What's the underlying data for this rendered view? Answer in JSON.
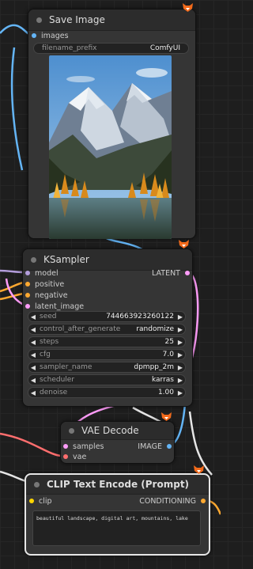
{
  "colors": {
    "image": "#64b5f6",
    "model": "#b39ddb",
    "conditioning": "#ffa931",
    "latent": "#ff9cf9",
    "vae": "#ff6e6e"
  },
  "save_image": {
    "title": "Save Image",
    "input_images": "images",
    "filename_prefix_label": "filename_prefix",
    "filename_prefix_value": "ComfyUI"
  },
  "ksampler": {
    "title": "KSampler",
    "inputs": [
      "model",
      "positive",
      "negative",
      "latent_image"
    ],
    "output": "LATENT",
    "widgets": [
      {
        "label": "seed",
        "value": "744663923260122"
      },
      {
        "label": "control_after_generate",
        "value": "randomize"
      },
      {
        "label": "steps",
        "value": "25"
      },
      {
        "label": "cfg",
        "value": "7.0"
      },
      {
        "label": "sampler_name",
        "value": "dpmpp_2m"
      },
      {
        "label": "scheduler",
        "value": "karras"
      },
      {
        "label": "denoise",
        "value": "1.00"
      }
    ]
  },
  "vae_decode": {
    "title": "VAE Decode",
    "inputs": [
      "samples",
      "vae"
    ],
    "output": "IMAGE"
  },
  "clip": {
    "title": "CLIP Text Encode (Prompt)",
    "input": "clip",
    "output": "CONDITIONING",
    "text": "beautiful landscape, digital art, mountains, lake"
  },
  "arrows": {
    "left": "◀",
    "right": "▶"
  }
}
